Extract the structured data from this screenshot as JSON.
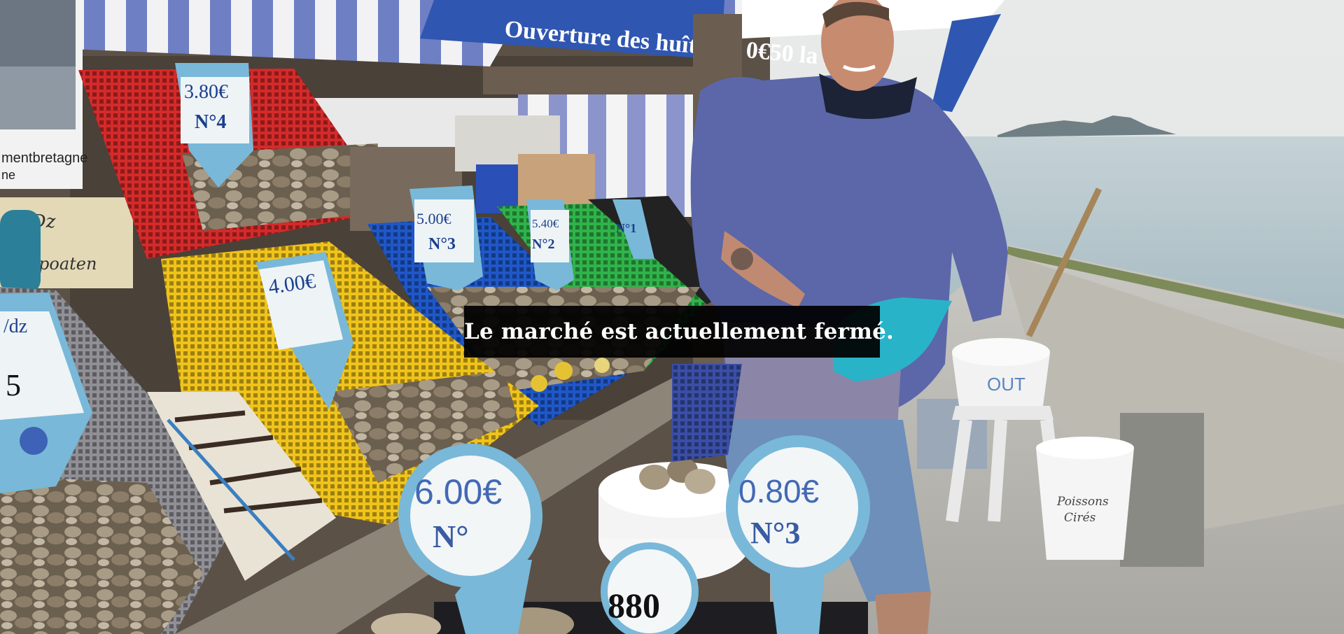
{
  "overlay": {
    "message": "Le marché est actuellement fermé."
  },
  "scene": {
    "banner_text": "Ouverture des huîtres : 0€50 la Dz",
    "poster_text": "mentbretagne",
    "poster_text_2": "ne",
    "price_tags": [
      {
        "price": "3.80€",
        "number": "N°4"
      },
      {
        "price": "5.00€",
        "number": "N°3"
      },
      {
        "price": "5.40€",
        "number": "N°2"
      },
      {
        "price": "N°1",
        "number": ""
      },
      {
        "price": "4.00€",
        "number": ""
      },
      {
        "price": "/dz",
        "number": "5"
      }
    ],
    "round_signs": [
      {
        "price": "6.00€",
        "number": "N°"
      },
      {
        "price": "0.80€",
        "number": "N°3"
      },
      {
        "price": "",
        "number": "880"
      }
    ],
    "bucket_labels": [
      "OUT",
      "Poissons Cirés"
    ],
    "colors": {
      "awning_blue": "#2f56b0",
      "sea": "#b9c9cf",
      "sky": "#e9ebea",
      "sweater": "#5a67a8",
      "glove": "#29b3c8"
    }
  }
}
